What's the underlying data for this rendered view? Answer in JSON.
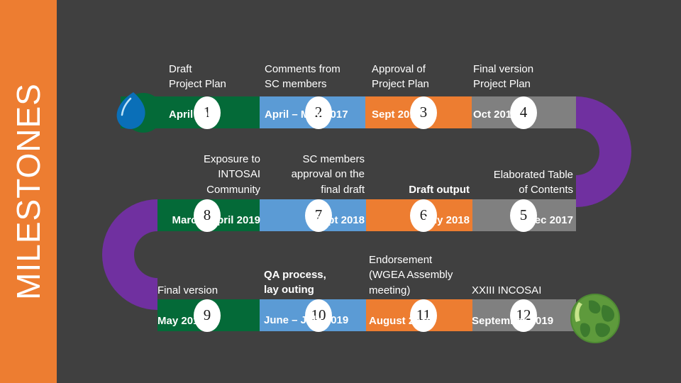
{
  "sidebar": {
    "title": "MILESTONES"
  },
  "colors": {
    "background": "#404040",
    "sidebar_orange": "#ED7D31",
    "green": "#046A38",
    "blue": "#5B9BD5",
    "orange": "#ED7D31",
    "gray": "#808080",
    "purple": "#7030A0",
    "white": "#FFFFFF"
  },
  "logos": {
    "droplet": "water-droplet-logo",
    "globe": "green-globe-icon"
  },
  "rows": [
    {
      "id": "row-1",
      "direction": "left-to-right",
      "caption_position": "above",
      "caption_align": "left",
      "milestones": [
        {
          "number": "1",
          "color": "green",
          "lead": "Draft\nProject Plan",
          "date": "April  2017"
        },
        {
          "number": "2",
          "color": "blue",
          "lead": "Comments from\nSC members",
          "date": "April – May 2017"
        },
        {
          "number": "3",
          "color": "orange",
          "lead": "Approval of\nProject Plan",
          "date": "Sept 2017"
        },
        {
          "number": "4",
          "color": "gray",
          "lead": "Final version\nProject Plan",
          "date": "Oct 2017"
        }
      ]
    },
    {
      "id": "row-2",
      "direction": "right-to-left",
      "caption_position": "above",
      "caption_align": "right",
      "milestones": [
        {
          "number": "8",
          "color": "green",
          "lead": "Exposure to\nINTOSAI\nCommunity",
          "date": "March- April 2019"
        },
        {
          "number": "7",
          "color": "blue",
          "lead": "SC members\napproval on the\nfinal draft",
          "date": "Sept 2018"
        },
        {
          "number": "6",
          "color": "orange",
          "lead": "Draft  output",
          "date": "July 2018",
          "lead_bold": true
        },
        {
          "number": "5",
          "color": "gray",
          "lead": "Elaborated Table\nof Contents",
          "date": "Dec 2017"
        }
      ]
    },
    {
      "id": "row-3",
      "direction": "left-to-right",
      "caption_position": "above",
      "caption_align": "left",
      "milestones": [
        {
          "number": "9",
          "color": "green",
          "lead": "Final version",
          "date": "May 2019"
        },
        {
          "number": "10",
          "color": "blue",
          "lead": "QA process,\nlay outing",
          "date": "June – July 2019",
          "lead_bold": true
        },
        {
          "number": "11",
          "color": "orange",
          "lead": "Endorsement\n(WGEA Assembly\nmeeting)",
          "date": "August 2019"
        },
        {
          "number": "12",
          "color": "gray",
          "lead": "XXIII INCOSAI",
          "date": "September 2019"
        }
      ]
    }
  ]
}
